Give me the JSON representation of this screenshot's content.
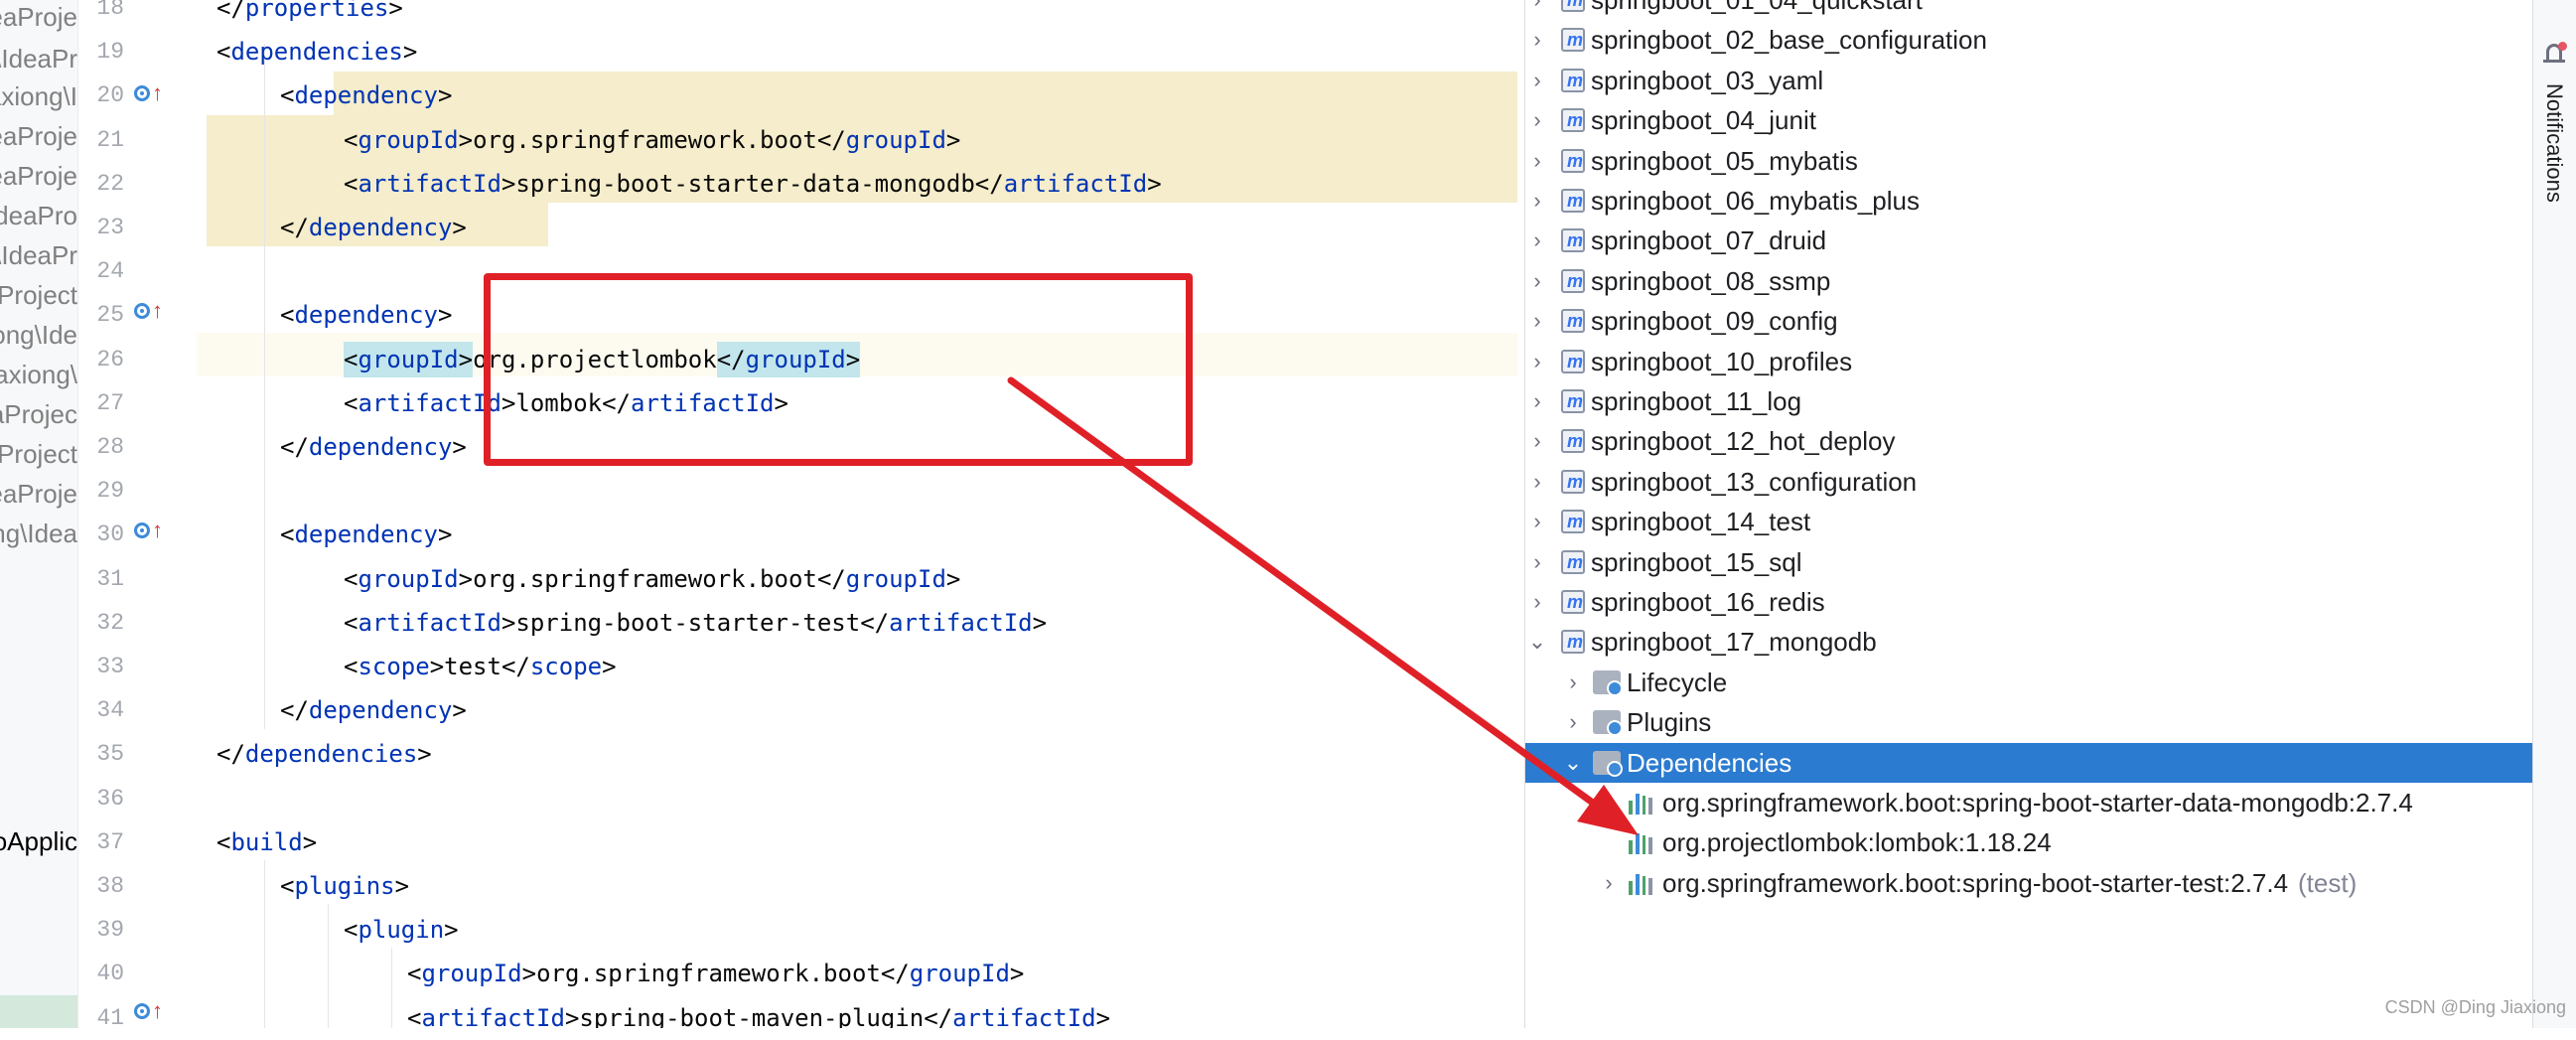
{
  "path_strip": {
    "items": [
      "eaProje",
      "\\IdeaPr",
      "iaxiong\\I",
      "eaProje",
      "eaProje",
      "IdeaPro",
      "\\IdeaPr",
      "Project",
      "ong\\Ide",
      "axiong\\",
      "aProjec",
      "Project",
      "eaProje",
      "ng\\Idea"
    ],
    "app_label": "oApplic"
  },
  "gutter": {
    "line_numbers": [
      "18",
      "19",
      "20",
      "21",
      "22",
      "23",
      "24",
      "25",
      "26",
      "27",
      "28",
      "29",
      "30",
      "31",
      "32",
      "33",
      "34",
      "35",
      "36",
      "37",
      "38",
      "39",
      "40",
      "41"
    ]
  },
  "editor": {
    "lines": [
      {
        "n": "18",
        "indent": "    ",
        "open": "</",
        "name": "properties",
        "rest": "",
        "close": ">",
        "text2": "",
        "close2": ""
      },
      {
        "n": "19",
        "indent": "    ",
        "open": "<",
        "name": "dependencies",
        "rest": "",
        "close": ">",
        "text2": "",
        "close2": ""
      },
      {
        "n": "20",
        "indent": "        ",
        "open": "<",
        "name": "dependency",
        "rest": "",
        "close": ">",
        "text2": "",
        "close2": ""
      },
      {
        "n": "21",
        "indent": "            ",
        "open": "<",
        "name": "groupId",
        "close": ">",
        "text": "org.springframework.boot",
        "close2": "groupId"
      },
      {
        "n": "22",
        "indent": "            ",
        "open": "<",
        "name": "artifactId",
        "close": ">",
        "text": "spring-boot-starter-data-mongodb",
        "close2": "artifactId"
      },
      {
        "n": "23",
        "indent": "        ",
        "open": "</",
        "name": "dependency",
        "rest": "",
        "close": ">",
        "text2": "",
        "close2": ""
      },
      {
        "n": "25",
        "indent": "        ",
        "open": "<",
        "name": "dependency",
        "rest": "",
        "close": ">",
        "text2": "",
        "close2": ""
      },
      {
        "n": "26",
        "indent": "            ",
        "open": "<",
        "name": "groupId",
        "close": ">",
        "text": "org.projectlombok",
        "close2": "groupId"
      },
      {
        "n": "27",
        "indent": "            ",
        "open": "<",
        "name": "artifactId",
        "close": ">",
        "text": "lombok",
        "close2": "artifactId"
      },
      {
        "n": "28",
        "indent": "        ",
        "open": "</",
        "name": "dependency",
        "rest": "",
        "close": ">",
        "text2": "",
        "close2": ""
      },
      {
        "n": "30",
        "indent": "        ",
        "open": "<",
        "name": "dependency",
        "rest": "",
        "close": ">",
        "text2": "",
        "close2": ""
      },
      {
        "n": "31",
        "indent": "            ",
        "open": "<",
        "name": "groupId",
        "close": ">",
        "text": "org.springframework.boot",
        "close2": "groupId"
      },
      {
        "n": "32",
        "indent": "            ",
        "open": "<",
        "name": "artifactId",
        "close": ">",
        "text": "spring-boot-starter-test",
        "close2": "artifactId"
      },
      {
        "n": "33",
        "indent": "            ",
        "open": "<",
        "name": "scope",
        "close": ">",
        "text": "test",
        "close2": "scope"
      },
      {
        "n": "34",
        "indent": "        ",
        "open": "</",
        "name": "dependency",
        "rest": "",
        "close": ">",
        "text2": "",
        "close2": ""
      },
      {
        "n": "35",
        "indent": "    ",
        "open": "</",
        "name": "dependencies",
        "rest": "",
        "close": ">",
        "text2": "",
        "close2": ""
      },
      {
        "n": "37",
        "indent": "    ",
        "open": "<",
        "name": "build",
        "rest": "",
        "close": ">",
        "text2": "",
        "close2": ""
      },
      {
        "n": "38",
        "indent": "        ",
        "open": "<",
        "name": "plugins",
        "rest": "",
        "close": ">",
        "text2": "",
        "close2": ""
      },
      {
        "n": "39",
        "indent": "            ",
        "open": "<",
        "name": "plugin",
        "rest": "",
        "close": ">",
        "text2": "",
        "close2": ""
      },
      {
        "n": "40",
        "indent": "                ",
        "open": "<",
        "name": "groupId",
        "close": ">",
        "text": "org.springframework.boot",
        "close2": "groupId"
      },
      {
        "n": "41",
        "indent": "                ",
        "open": "<",
        "name": "artifactId",
        "close": ">",
        "text": "spring-boot-maven-plugin",
        "close2": "artifactId"
      }
    ]
  },
  "maven_tree": {
    "projects": [
      "springboot_01_04_quickstart",
      "springboot_02_base_configuration",
      "springboot_03_yaml",
      "springboot_04_junit",
      "springboot_05_mybatis",
      "springboot_06_mybatis_plus",
      "springboot_07_druid",
      "springboot_08_ssmp",
      "springboot_09_config",
      "springboot_10_profiles",
      "springboot_11_log",
      "springboot_12_hot_deploy",
      "springboot_13_configuration",
      "springboot_14_test",
      "springboot_15_sql",
      "springboot_16_redis",
      "springboot_17_mongodb"
    ],
    "module_children": [
      "Lifecycle",
      "Plugins",
      "Dependencies"
    ],
    "dependencies": [
      {
        "name": "org.springframework.boot:spring-boot-starter-data-mongodb:2.7.4",
        "scope": "",
        "expandable": true
      },
      {
        "name": "org.projectlombok:lombok:1.18.24",
        "scope": "",
        "expandable": false
      },
      {
        "name": "org.springframework.boot:spring-boot-starter-test:2.7.4",
        "scope": "(test)",
        "expandable": true
      }
    ]
  },
  "toolstrip": {
    "notifications_label": "Notifications"
  },
  "watermark": "CSDN @Ding Jiaxiong",
  "colors": {
    "tag": "#0033b3",
    "selection": "#2b7bd0",
    "highlight_block": "#f5edcb",
    "annotation_red": "#e02027"
  }
}
